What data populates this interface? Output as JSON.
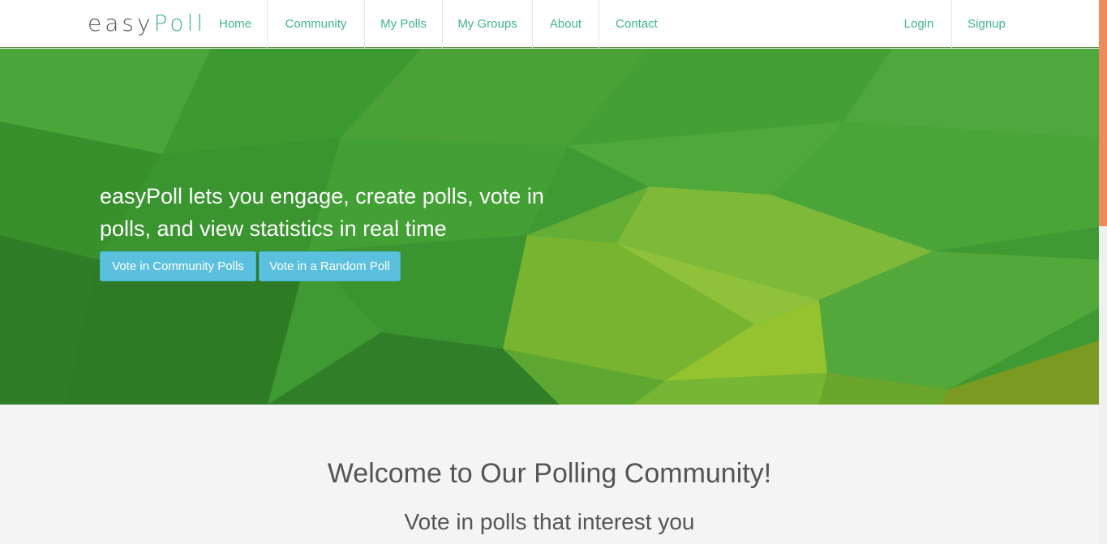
{
  "brand": {
    "part1": "easy",
    "part2": "Poll"
  },
  "nav": {
    "left": [
      "Home",
      "Community",
      "My Polls",
      "My Groups",
      "About",
      "Contact"
    ],
    "right": [
      "Login",
      "Signup"
    ]
  },
  "hero": {
    "headline": "easyPoll lets you engage, create polls, vote in polls, and view statistics in real time",
    "buttons": [
      "Vote in Community Polls",
      "Vote in a Random Poll"
    ]
  },
  "main": {
    "welcome": "Welcome to Our Polling Community!",
    "subheading": "Vote in polls that interest you"
  },
  "colors": {
    "accent": "#3fb58a",
    "button": "#5bc0de",
    "hero_green": "#3f9a33",
    "scroll_thumb": "#f08a5d"
  }
}
